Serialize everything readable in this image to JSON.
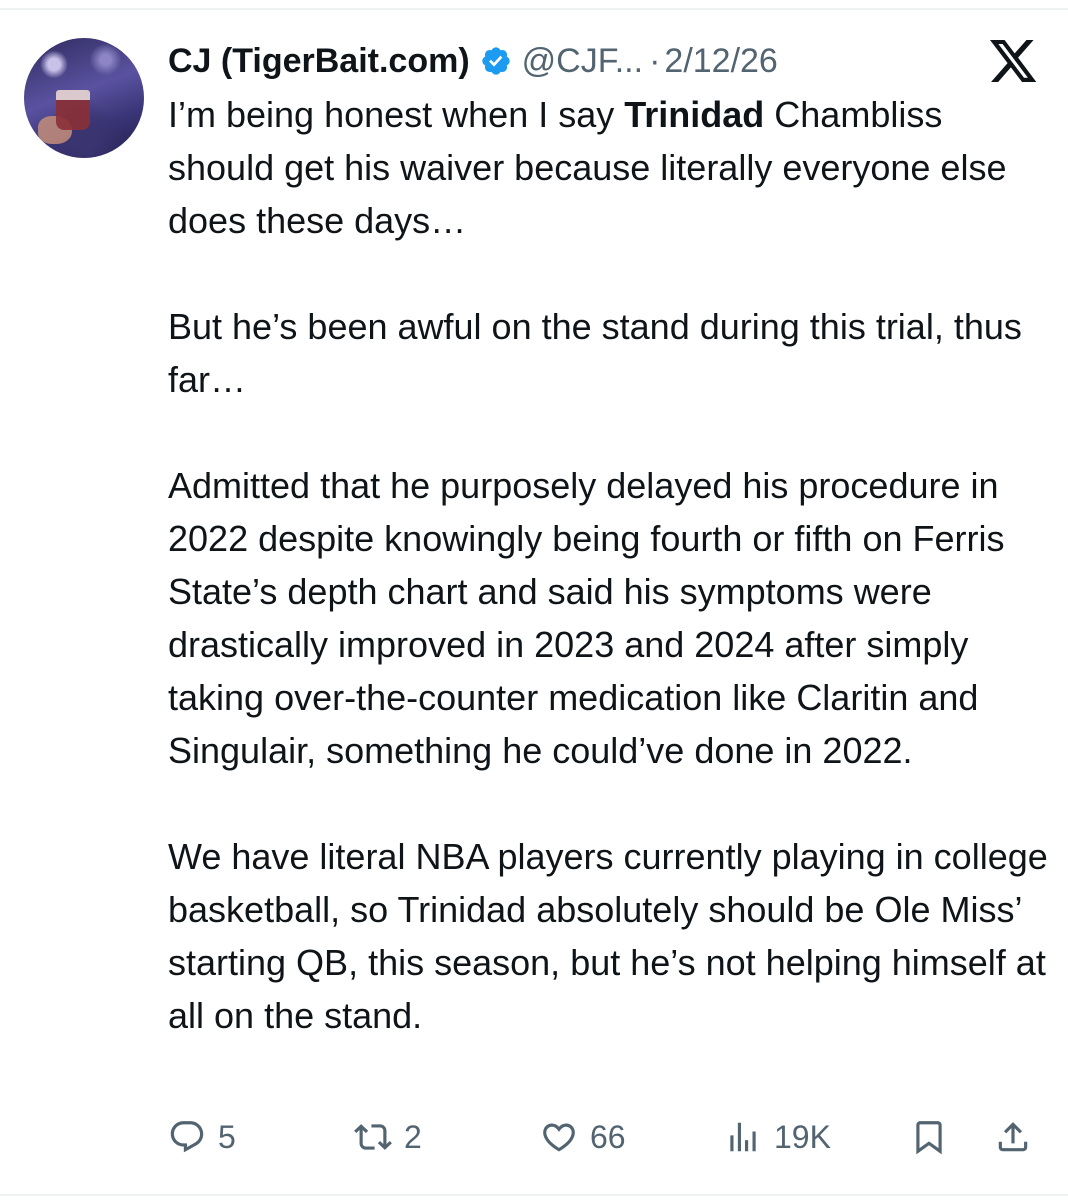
{
  "author": {
    "display_name": "CJ (TigerBait.com)",
    "handle": "@CJF...",
    "separator": "·",
    "date": "2/12/26"
  },
  "tweet": {
    "p1_a": "I’m being honest when I say ",
    "p1_bold": "Trinidad",
    "p1_b": " Chambliss should get his waiver because literally everyone else does these days…",
    "p2": "But he’s been awful on the stand during this trial, thus far…",
    "p3": "Admitted that he purposely delayed his procedure in 2022 despite knowingly being fourth or fifth on Ferris State’s depth chart and said his symptoms were drastically improved in 2023 and 2024 after simply taking over-the-counter medication like Claritin and Singulair, something he could’ve done in 2022.",
    "p4": "We have literal NBA players currently playing in college basketball, so Trinidad absolutely should be Ole Miss’ starting QB, this season, but he’s not helping himself at all on the stand."
  },
  "actions": {
    "replies": "5",
    "reposts": "2",
    "likes": "66",
    "views": "19K"
  },
  "colors": {
    "text": "#0f1419",
    "secondary": "#536471",
    "verified": "#1d9bf0"
  },
  "icons": [
    "verified-badge-icon",
    "x-logo-icon",
    "reply-icon",
    "repost-icon",
    "like-icon",
    "views-icon",
    "bookmark-icon",
    "share-icon"
  ]
}
